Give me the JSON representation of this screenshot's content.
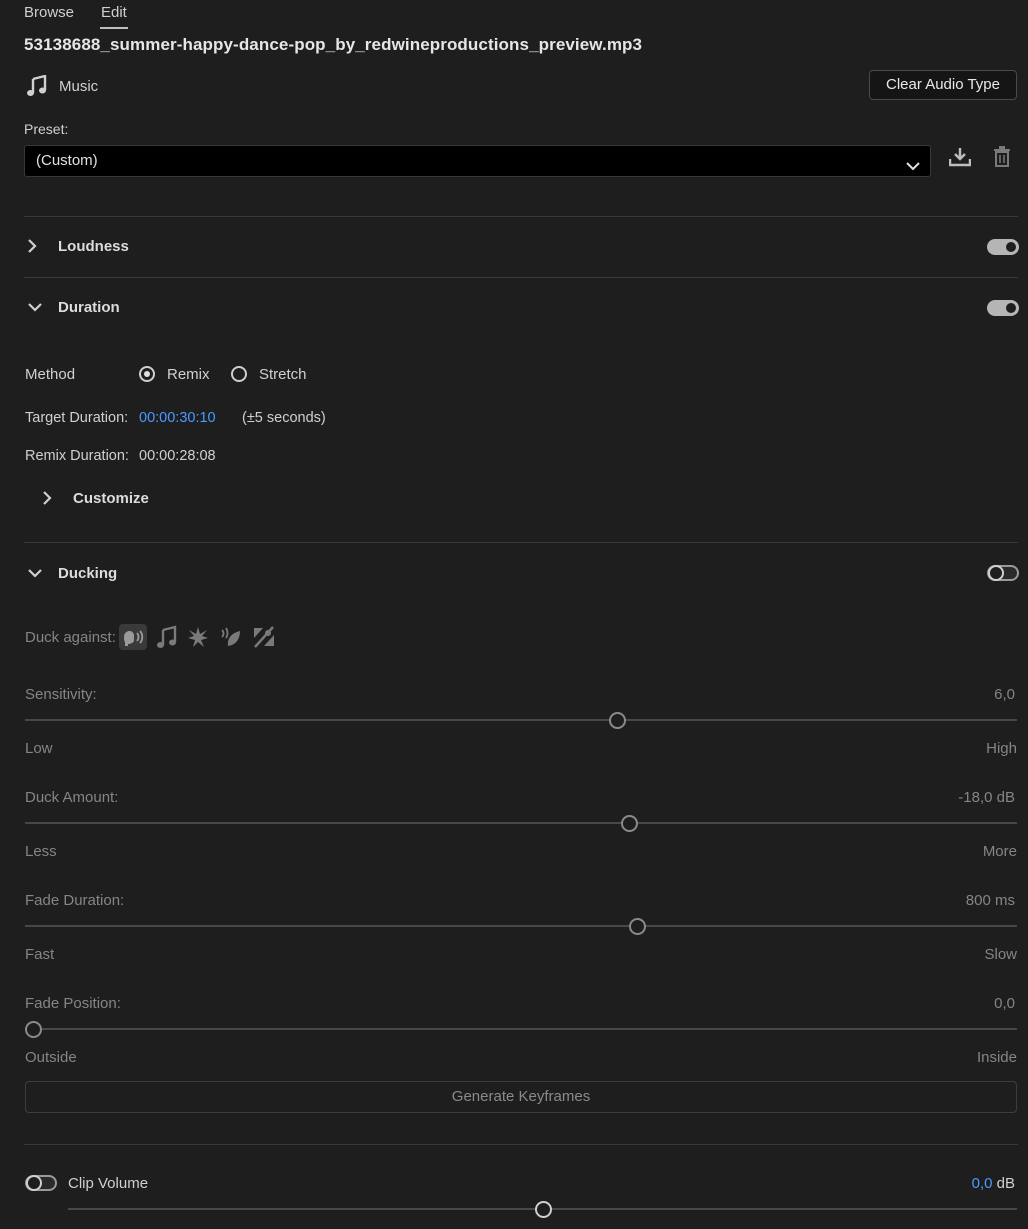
{
  "tabs": [
    {
      "label": "Browse"
    },
    {
      "label": "Edit"
    }
  ],
  "file_name": "53138688_summer-happy-dance-pop_by_redwineproductions_preview.mp3",
  "audio_type": {
    "label": "Music",
    "icon": "music-note-icon",
    "clear_button": "Clear Audio Type"
  },
  "preset": {
    "label": "Preset:",
    "value": "(Custom)",
    "save_icon": "save-preset-icon",
    "delete_icon": "delete-preset-icon"
  },
  "sections": {
    "loudness": {
      "title": "Loudness",
      "enabled": true,
      "expanded": false
    },
    "duration": {
      "title": "Duration",
      "enabled": true,
      "expanded": true,
      "method_label": "Method",
      "methods": [
        {
          "label": "Remix",
          "selected": true
        },
        {
          "label": "Stretch",
          "selected": false
        }
      ],
      "target_label": "Target Duration:",
      "target_value": "00:00:30:10",
      "target_tolerance": "(±5 seconds)",
      "remix_label": "Remix Duration:",
      "remix_value": "00:00:28:08",
      "customize": "Customize"
    },
    "ducking": {
      "title": "Ducking",
      "enabled": false,
      "expanded": true,
      "duck_against": "Duck against:",
      "duck_icons": [
        "dialogue-icon",
        "music-icon",
        "sfx-icon",
        "ambience-icon",
        "unclassified-icon"
      ],
      "sliders": [
        {
          "label": "Sensitivity:",
          "value": "6,0",
          "min": "Low",
          "max": "High",
          "position": 0.6
        },
        {
          "label": "Duck Amount:",
          "value": "-18,0 dB",
          "min": "Less",
          "max": "More",
          "position": 0.61
        },
        {
          "label": "Fade Duration:",
          "value": "800 ms",
          "min": "Fast",
          "max": "Slow",
          "position": 0.618
        },
        {
          "label": "Fade Position:",
          "value": "0,0",
          "min": "Outside",
          "max": "Inside",
          "position": 0.0
        }
      ],
      "generate_button": "Generate Keyframes"
    }
  },
  "clip_volume": {
    "label": "Clip Volume",
    "value": "0,0",
    "unit": "dB",
    "enabled": false,
    "position": 0.5
  },
  "colors": {
    "accent": "#4a9bff",
    "background": "#1e1e1e"
  }
}
